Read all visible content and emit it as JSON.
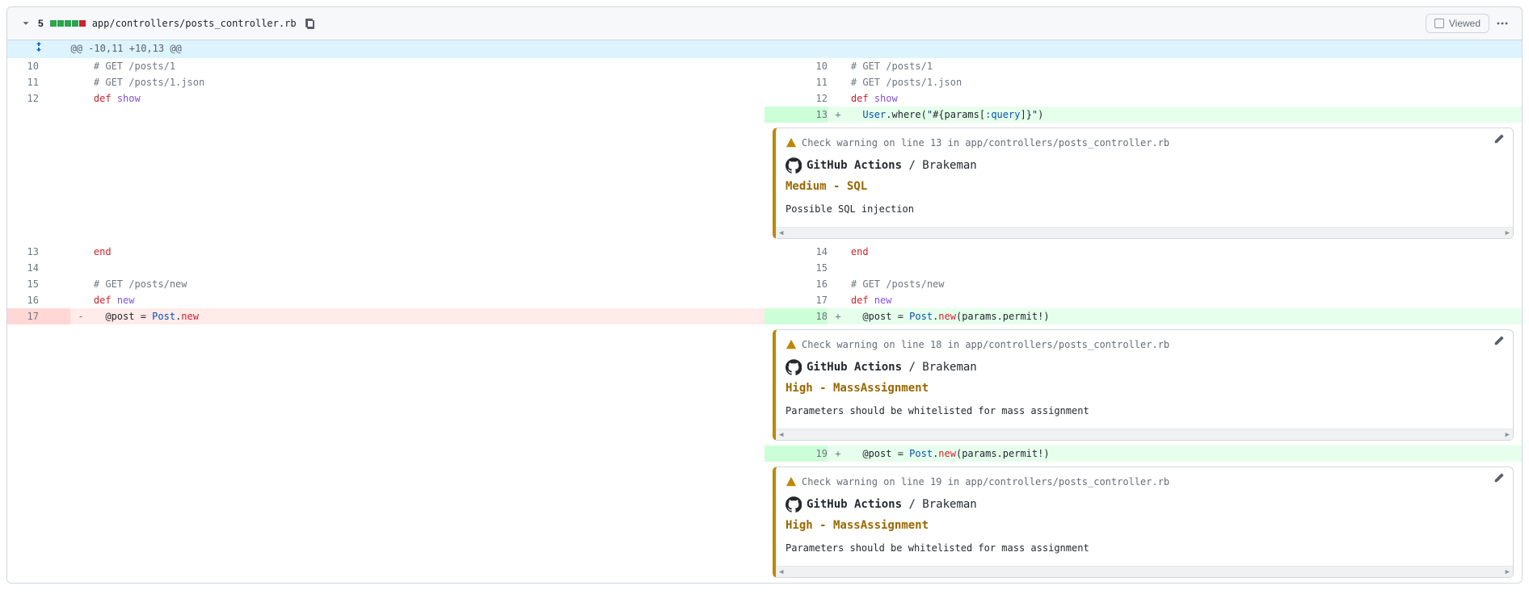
{
  "file": {
    "change_count": "5",
    "path": "app/controllers/posts_controller.rb",
    "viewed_label": "Viewed"
  },
  "hunk": "@@ -10,11 +10,13 @@",
  "ghActionsLabel": "GitHub Actions",
  "brakemanLabel": "Brakeman",
  "rows": [
    {
      "type": "ctx",
      "lOld": "10",
      "lNew": "10",
      "leftHtml": "    <span class='c-comment'># GET /posts/1</span>",
      "rightHtml": "    <span class='c-comment'># GET /posts/1</span>"
    },
    {
      "type": "ctx",
      "lOld": "11",
      "lNew": "11",
      "leftHtml": "    <span class='c-comment'># GET /posts/1.json</span>",
      "rightHtml": "    <span class='c-comment'># GET /posts/1.json</span>"
    },
    {
      "type": "ctx",
      "lOld": "12",
      "lNew": "12",
      "leftHtml": "    <span class='c-kw'>def</span> <span class='c-def'>show</span>",
      "rightHtml": "    <span class='c-kw'>def</span> <span class='c-def'>show</span>"
    },
    {
      "type": "add",
      "lNew": "13",
      "rightHtml": "      <span class='c-const'>User</span>.where(<span class='c-sym'>\"</span>#{params[<span class='c-const'>:query</span>]}<span class='c-sym'>\"</span>)"
    },
    {
      "type": "annotation",
      "side": "right",
      "warning": "Check warning on line 13 in app/controllers/posts_controller.rb",
      "level": "Medium - SQL",
      "message": "Possible SQL injection"
    },
    {
      "type": "ctx",
      "lOld": "13",
      "lNew": "14",
      "leftHtml": "    <span class='c-kw'>end</span>",
      "rightHtml": "    <span class='c-kw'>end</span>"
    },
    {
      "type": "ctx",
      "lOld": "14",
      "lNew": "15",
      "leftHtml": "",
      "rightHtml": ""
    },
    {
      "type": "ctx",
      "lOld": "15",
      "lNew": "16",
      "leftHtml": "    <span class='c-comment'># GET /posts/new</span>",
      "rightHtml": "    <span class='c-comment'># GET /posts/new</span>"
    },
    {
      "type": "ctx",
      "lOld": "16",
      "lNew": "17",
      "leftHtml": "    <span class='c-kw'>def</span> <span class='c-def'>new</span>",
      "rightHtml": "    <span class='c-kw'>def</span> <span class='c-def'>new</span>"
    },
    {
      "type": "delAdd",
      "lOld": "17",
      "lNew": "18",
      "leftHtml": "      @post = <span class='c-const'>Post</span>.<span class='c-kw'>new</span>",
      "rightHtml": "      @post = <span class='c-const'>Post</span>.<span class='c-kw'>new</span>(params.permit!)"
    },
    {
      "type": "annotation",
      "side": "right",
      "warning": "Check warning on line 18 in app/controllers/posts_controller.rb",
      "level": "High - MassAssignment",
      "message": "Parameters should be whitelisted for mass assignment"
    },
    {
      "type": "add",
      "lNew": "19",
      "rightHtml": "      @post = <span class='c-const'>Post</span>.<span class='c-kw'>new</span>(params.permit!)"
    },
    {
      "type": "annotation",
      "side": "right",
      "warning": "Check warning on line 19 in app/controllers/posts_controller.rb",
      "level": "High - MassAssignment",
      "message": "Parameters should be whitelisted for mass assignment"
    }
  ]
}
